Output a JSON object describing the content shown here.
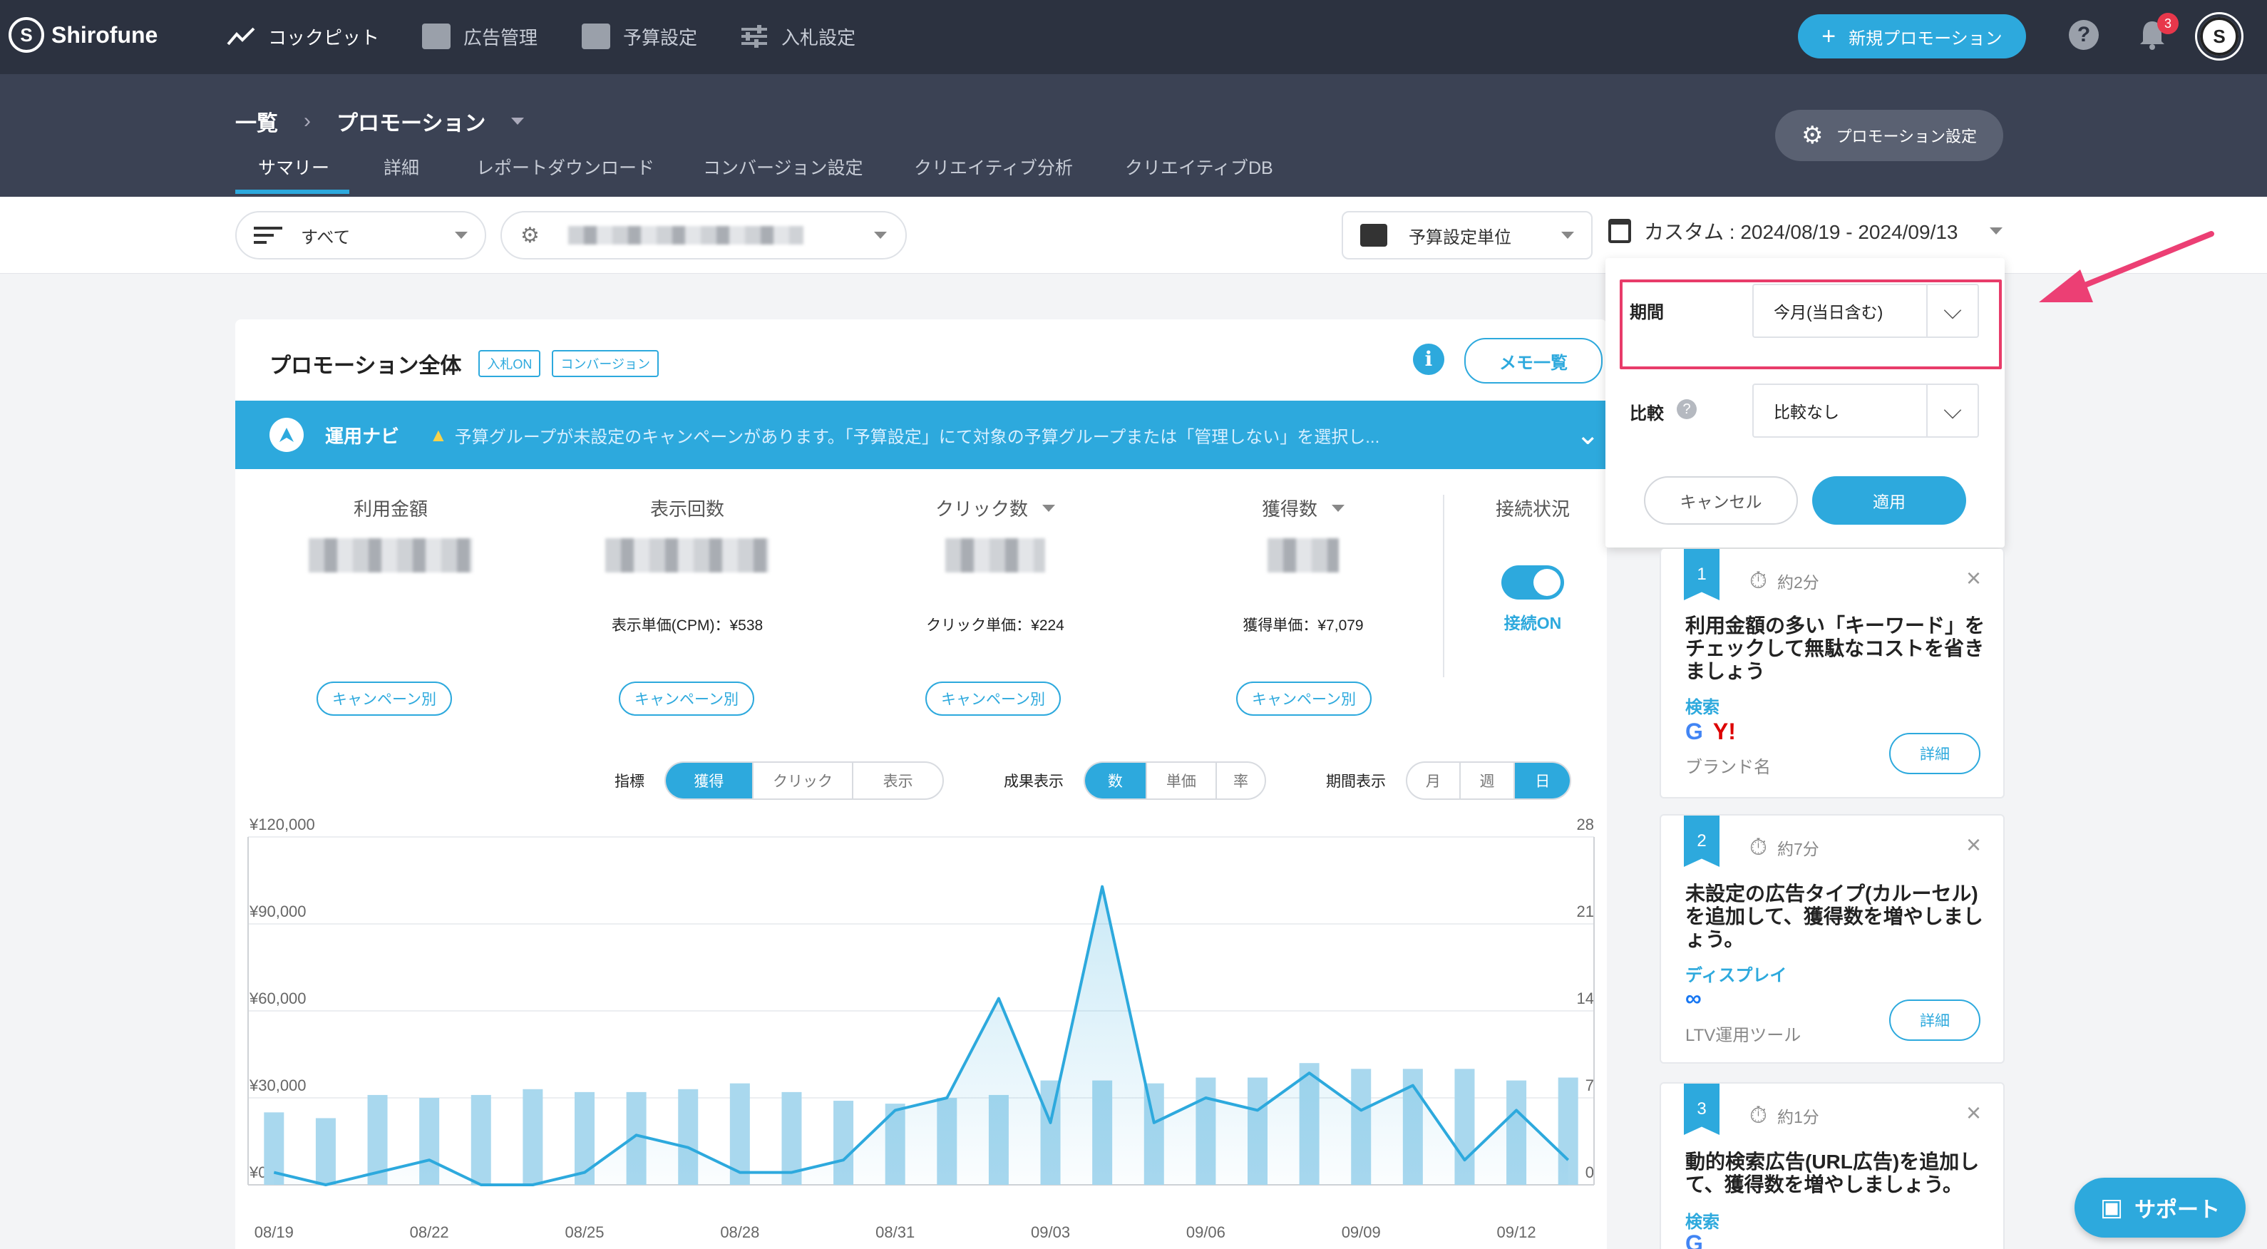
{
  "app": {
    "brand": "Shirofune",
    "nav": [
      "コックピット",
      "広告管理",
      "予算設定",
      "入札設定"
    ],
    "new_promo": "新規プロモーション",
    "notif_count": "3"
  },
  "header": {
    "breadcrumb_root": "一覧",
    "breadcrumb_current": "プロモーション",
    "tabs": [
      "サマリー",
      "詳細",
      "レポートダウンロード",
      "コンバージョン設定",
      "クリエイティブ分析",
      "クリエイティブDB"
    ],
    "settings_btn": "プロモーション設定"
  },
  "filters": {
    "all": "すべて",
    "budget_unit": "予算設定単位",
    "date_range": "カスタム : 2024/08/19 - 2024/09/13"
  },
  "popover": {
    "period_label": "期間",
    "period_value": "今月(当日含む)",
    "compare_label": "比較",
    "compare_value": "比較なし",
    "cancel": "キャンセル",
    "apply": "適用"
  },
  "panel": {
    "title": "プロモーション全体",
    "tag1": "入札ON",
    "tag2": "コンバージョン",
    "memo": "メモ一覧",
    "navi_label": "運用ナビ",
    "navi_text": "予算グループが未設定のキャンペーンがあります。「予算設定」にて対象の予算グループまたは「管理しない」を選択し..."
  },
  "metrics": [
    {
      "label": "利用金額",
      "sub": "",
      "btn": "キャンペーン別"
    },
    {
      "label": "表示回数",
      "sub": "表示単価(CPM)：¥538",
      "btn": "キャンペーン別"
    },
    {
      "label": "クリック数",
      "sub": "クリック単価：¥224",
      "btn": "キャンペーン別"
    },
    {
      "label": "獲得数",
      "sub": "獲得単価：¥7,079",
      "btn": "キャンペーン別"
    }
  ],
  "connection": {
    "label": "接続状況",
    "status": "接続ON"
  },
  "controls": {
    "metric_label": "指標",
    "metric_opts": [
      "獲得",
      "クリック",
      "表示"
    ],
    "result_label": "成果表示",
    "result_opts": [
      "数",
      "単価",
      "率"
    ],
    "period_label": "期間表示",
    "period_opts": [
      "月",
      "週",
      "日"
    ]
  },
  "recommendations": [
    {
      "num": "1",
      "time": "約2分",
      "title": "利用金額の多い「キーワード」をチェックして無駄なコストを省きましょう",
      "category": "検索",
      "sub": "ブランド名",
      "btn": "詳細"
    },
    {
      "num": "2",
      "time": "約7分",
      "title": "未設定の広告タイプ(カルーセル)を追加して、獲得数を増やしましょう。",
      "category": "ディスプレイ",
      "sub": "LTV運用ツール",
      "btn": "詳細"
    },
    {
      "num": "3",
      "time": "約1分",
      "title": "動的検索広告(URL広告)を追加して、獲得数を増やしましょう。",
      "category": "検索",
      "sub": "",
      "btn": "詳細"
    }
  ],
  "support": "サポート",
  "chart_data": {
    "type": "bar",
    "x": [
      "08/19",
      "08/20",
      "08/21",
      "08/22",
      "08/23",
      "08/24",
      "08/25",
      "08/26",
      "08/27",
      "08/28",
      "08/29",
      "08/30",
      "08/31",
      "09/01",
      "09/02",
      "09/03",
      "09/04",
      "09/05",
      "09/06",
      "09/07",
      "09/08",
      "09/09",
      "09/10",
      "09/11",
      "09/12",
      "09/13"
    ],
    "x_tick_labels": [
      "08/19",
      "08/22",
      "08/25",
      "08/28",
      "08/31",
      "09/03",
      "09/06",
      "09/09",
      "09/12"
    ],
    "y_left_ticks": [
      "¥120,000",
      "¥90,000",
      "¥60,000",
      "¥30,000",
      "¥0"
    ],
    "y_right_ticks": [
      "28",
      "21",
      "14",
      "7",
      "0"
    ],
    "ylim_left": [
      0,
      120000
    ],
    "ylim_right": [
      0,
      28
    ],
    "series": [
      {
        "axis": "left",
        "type": "bar",
        "color": "#a9d8ee",
        "values": [
          25000,
          23000,
          31000,
          30000,
          31000,
          33000,
          32000,
          32000,
          33000,
          35000,
          32000,
          29000,
          28000,
          30000,
          31000,
          36000,
          36000,
          35000,
          37000,
          37000,
          42000,
          40000,
          40000,
          40000,
          36000,
          37000
        ]
      },
      {
        "axis": "right",
        "type": "line",
        "color": "#2da9dd",
        "values": [
          1,
          0,
          1,
          2,
          0,
          0,
          1,
          4,
          3,
          1,
          1,
          2,
          6,
          7,
          15,
          5,
          24,
          5,
          7,
          6,
          9,
          6,
          8,
          2,
          6,
          2
        ]
      }
    ]
  }
}
